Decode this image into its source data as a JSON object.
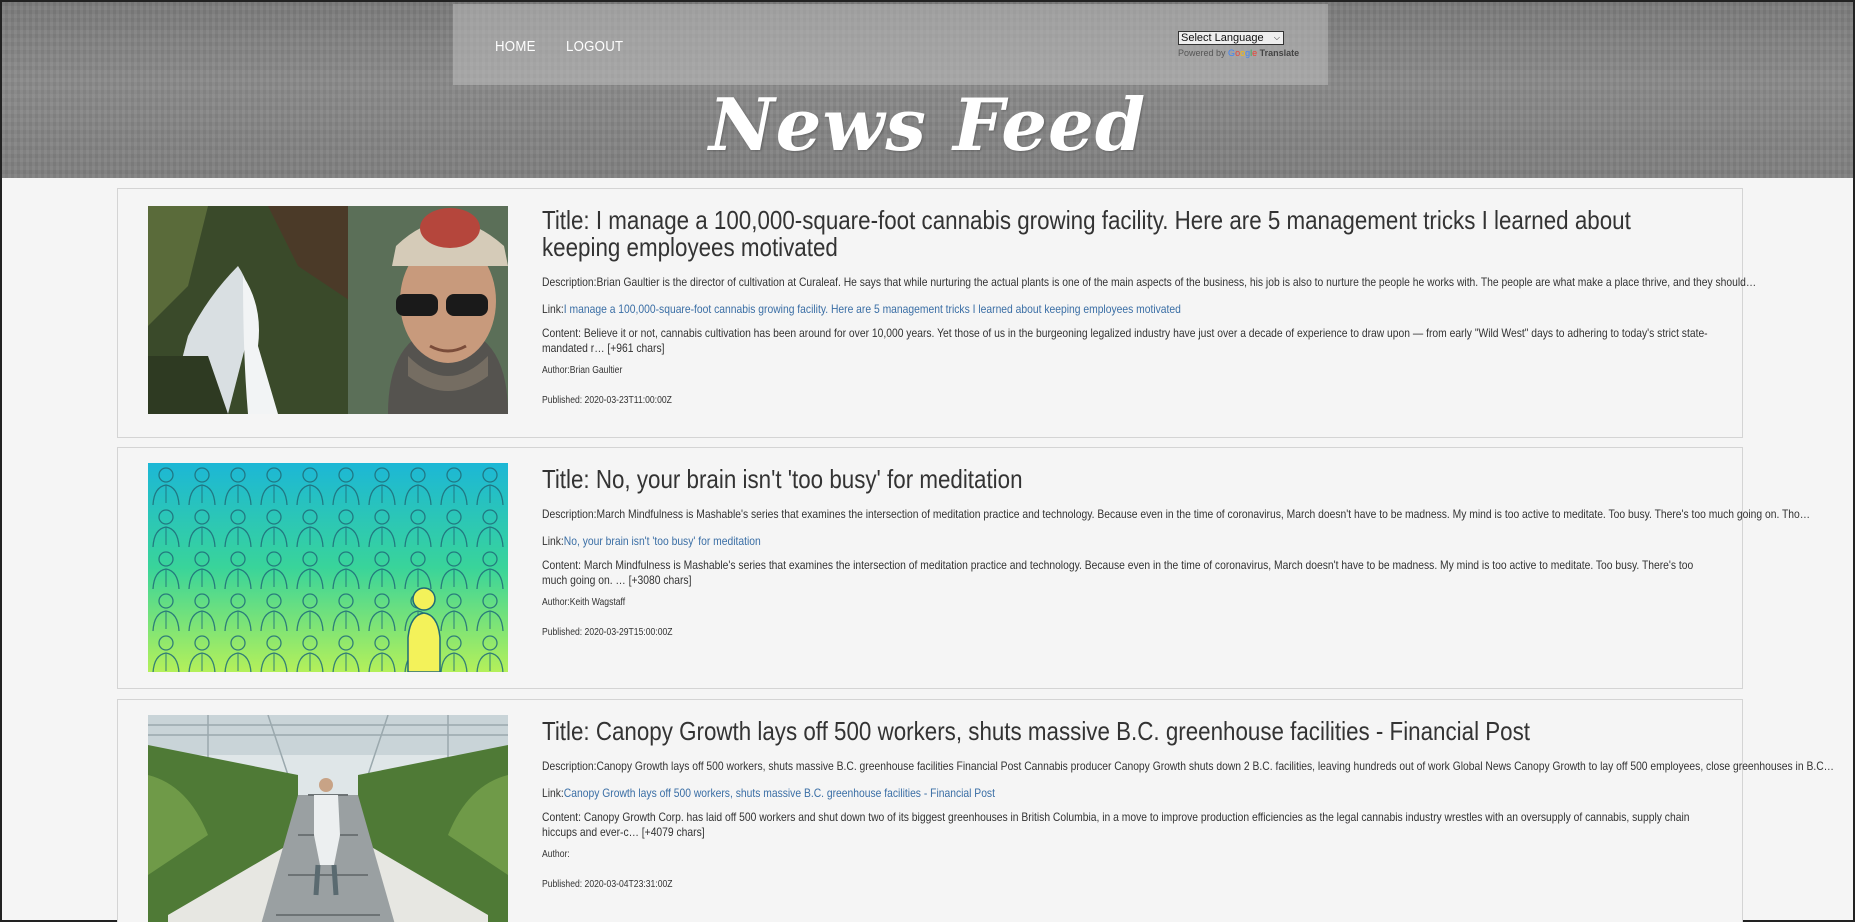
{
  "nav": {
    "home": "HOME",
    "logout": "LOGOUT"
  },
  "translate": {
    "select_label": "Select Language",
    "powered_by": "Powered by",
    "google": [
      "G",
      "o",
      "o",
      "g",
      "l",
      "e"
    ],
    "translate": "Translate"
  },
  "header": {
    "title": "News Feed"
  },
  "articles": [
    {
      "title": "Title: I manage a 100,000-square-foot cannabis growing facility. Here are 5 management tricks I learned about keeping employees motivated",
      "description": "Description:Brian Gaultier is the director of cultivation at Curaleaf. He says that while nurturing the actual plants is one of the main aspects of the business, his job is also to nurture the people he works with. The people are what make a place thrive, and they should…",
      "link_prefix": "Link:",
      "link_text": "I manage a 100,000-square-foot cannabis growing facility. Here are 5 management tricks I learned about keeping employees motivated",
      "content": "Content: Believe it or not, cannabis cultivation has been around for over 10,000 years. Yet those of us in the burgeoning legalized industry have just over a decade of experience to draw upon — from early \"Wild West\" days to adhering to today's strict state-mandated r… [+961 chars]",
      "author": "Author:Brian Gaultier",
      "published": "Published: 2020-03-23T11:00:00Z"
    },
    {
      "title": "Title: No, your brain isn't 'too busy' for meditation",
      "description": "Description:March Mindfulness is Mashable's series that examines the intersection of meditation practice and technology. Because even in the time of coronavirus, March doesn't have to be madness. My mind is too active to meditate. Too busy. There's too much going on. Tho…",
      "link_prefix": "Link:",
      "link_text": "No, your brain isn't 'too busy' for meditation",
      "content": "Content: March Mindfulness is Mashable's series that examines the intersection of meditation practice and technology. Because even in the time of coronavirus, March doesn't have to be madness.  My mind is too active to meditate. Too busy. There's too much going on.  … [+3080 chars]",
      "author": "Author:Keith Wagstaff",
      "published": "Published: 2020-03-29T15:00:00Z"
    },
    {
      "title": "Title: Canopy Growth lays off 500 workers, shuts massive B.C. greenhouse facilities - Financial Post",
      "description": "Description:Canopy Growth lays off 500 workers, shuts massive B.C. greenhouse facilities Financial Post Cannabis producer Canopy Growth shuts down 2 B.C. facilities, leaving hundreds out of work Global News Canopy Growth to lay off 500 employees, close greenhouses in B.C…",
      "link_prefix": "Link:",
      "link_text": "Canopy Growth lays off 500 workers, shuts massive B.C. greenhouse facilities - Financial Post",
      "content": "Content: Canopy Growth Corp. has laid off 500 workers and shut down two of its biggest greenhouses in British Columbia, in a move to improve production efficiencies as the legal cannabis industry wrestles with an oversupply of cannabis, supply chain hiccups and ever-c… [+4079 chars]",
      "author": "Author:",
      "published": "Published: 2020-03-04T23:31:00Z"
    }
  ]
}
